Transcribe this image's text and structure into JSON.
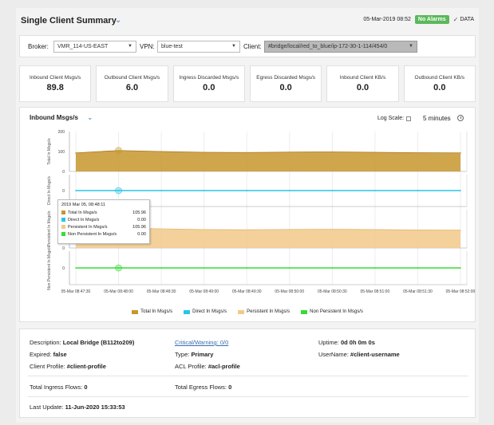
{
  "header": {
    "title": "Single Client Summary",
    "timestamp": "05-Mar-2019 08:52",
    "alarm_badge": "No Alarms",
    "data_label": "DATA"
  },
  "selectors": {
    "broker_label": "Broker:",
    "broker_value": "VMR_114-US-EAST",
    "vpn_label": "VPN:",
    "vpn_value": "blue-test",
    "client_label": "Client:",
    "client_value": "#bridge/local/red_to_blue/ip-172-30-1-114/454/0"
  },
  "kpis": [
    {
      "label": "Inbound Client Msgs/s",
      "value": "89.8"
    },
    {
      "label": "Outbound Client Msgs/s",
      "value": "6.0"
    },
    {
      "label": "Ingress Discarded Msgs/s",
      "value": "0.0"
    },
    {
      "label": "Egress Discarded Msgs/s",
      "value": "0.0"
    },
    {
      "label": "Inbound Client KB/s",
      "value": "0.0"
    },
    {
      "label": "Outbound Client KB/s",
      "value": "0.0"
    }
  ],
  "chart_panel": {
    "title": "Inbound Msgs/s",
    "log_scale_label": "Log Scale:",
    "time_range": "5 minutes"
  },
  "chart_data": {
    "type": "area",
    "x": [
      "05-Mar 08:47:30",
      "05-Mar 08:48:00",
      "05-Mar 08:48:30",
      "05-Mar 08:49:00",
      "05-Mar 08:49:30",
      "05-Mar 08:50:00",
      "05-Mar 08:50:30",
      "05-Mar 08:51:00",
      "05-Mar 08:51:30",
      "05-Mar 08:52:00"
    ],
    "series": [
      {
        "name": "Total In Msgs/s",
        "color": "#c8962e",
        "ylabel": "Total In Msgs/s",
        "ylim": [
          0,
          200
        ],
        "yticks": [
          0,
          100,
          200
        ],
        "values": [
          93,
          105,
          100,
          96,
          95,
          97,
          98,
          96,
          94,
          93
        ]
      },
      {
        "name": "Direct In Msgs/s",
        "color": "#29c5e6",
        "ylabel": "Direct In Msgs/s",
        "ylim": [
          0,
          0
        ],
        "yticks": [
          0
        ],
        "values": [
          0,
          0,
          0,
          0,
          0,
          0,
          0,
          0,
          0,
          0
        ]
      },
      {
        "name": "Persistent In Msgs/s",
        "color": "#f2c98a",
        "ylabel": "Persistent In Msgs/s",
        "ylim": [
          0,
          200
        ],
        "yticks": [
          0
        ],
        "values": [
          93,
          105,
          100,
          96,
          95,
          97,
          98,
          96,
          94,
          93
        ]
      },
      {
        "name": "Non Persistent In Msgs/s",
        "color": "#33dd33",
        "ylabel": "Non Persistent In Msgs/s",
        "ylim": [
          0,
          0
        ],
        "yticks": [
          0
        ],
        "values": [
          0,
          0,
          0,
          0,
          0,
          0,
          0,
          0,
          0,
          0
        ]
      }
    ],
    "grid": true,
    "legend": "bottom"
  },
  "tooltip": {
    "time": "2019 Mar 05, 08:48:11",
    "rows": [
      {
        "name": "Total In Msgs/s",
        "value": "105.96",
        "color": "#c8962e"
      },
      {
        "name": "Direct In Msgs/s",
        "value": "0.00",
        "color": "#29c5e6"
      },
      {
        "name": "Persistent In Msgs/s",
        "value": "105.96",
        "color": "#f2c98a"
      },
      {
        "name": "Non Persistent In Msgs/s",
        "value": "0.00",
        "color": "#33dd33"
      }
    ]
  },
  "info": {
    "description_label": "Description:",
    "description_value": "Local Bridge (B112to209)",
    "critical_link": "Critical/Warning: 0/0",
    "uptime_label": "Uptime:",
    "uptime_value": "0d 0h 0m 0s",
    "expired_label": "Expired:",
    "expired_value": "false",
    "type_label": "Type:",
    "type_value": "Primary",
    "username_label": "UserName:",
    "username_value": "#client-username",
    "client_profile_label": "Client Profile:",
    "client_profile_value": "#client-profile",
    "acl_profile_label": "ACL Profile:",
    "acl_profile_value": "#acl-profile",
    "ingress_flows_label": "Total Ingress Flows:",
    "ingress_flows_value": "0",
    "egress_flows_label": "Total Egress Flows:",
    "egress_flows_value": "0",
    "last_update_label": "Last Update:",
    "last_update_value": "11-Jun-2020 15:33:53"
  }
}
